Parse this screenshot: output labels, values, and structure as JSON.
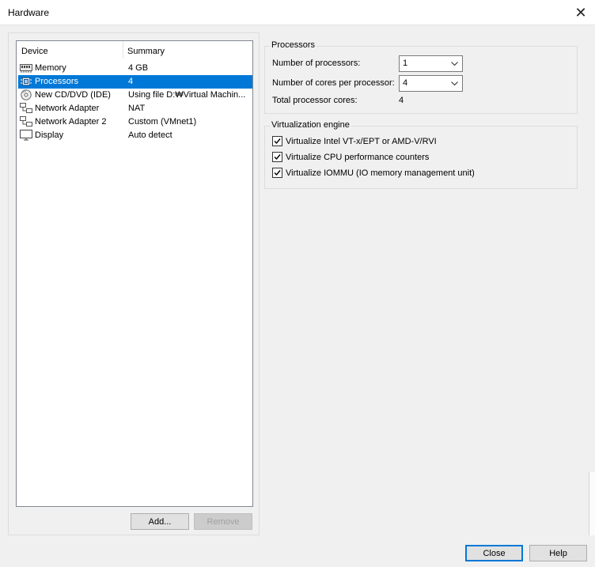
{
  "window": {
    "title": "Hardware"
  },
  "device_list": {
    "columns": {
      "device": "Device",
      "summary": "Summary"
    },
    "items": [
      {
        "name": "Memory",
        "summary": "4 GB",
        "icon": "memory-icon"
      },
      {
        "name": "Processors",
        "summary": "4",
        "icon": "processor-icon",
        "selected": true
      },
      {
        "name": "New CD/DVD (IDE)",
        "summary": "Using file D:₩Virtual Machin...",
        "icon": "cd-dvd-icon"
      },
      {
        "name": "Network Adapter",
        "summary": "NAT",
        "icon": "network-adapter-icon"
      },
      {
        "name": "Network Adapter 2",
        "summary": "Custom (VMnet1)",
        "icon": "network-adapter-icon"
      },
      {
        "name": "Display",
        "summary": "Auto detect",
        "icon": "display-icon"
      }
    ]
  },
  "buttons": {
    "add": "Add...",
    "remove": "Remove",
    "close": "Close",
    "help": "Help"
  },
  "processors": {
    "legend": "Processors",
    "num_processors_label": "Number of processors:",
    "num_processors_value": "1",
    "cores_label": "Number of cores per processor:",
    "cores_value": "4",
    "total_label": "Total processor cores:",
    "total_value": "4"
  },
  "virtualization": {
    "legend": "Virtualization engine",
    "options": [
      {
        "label": "Virtualize Intel VT-x/EPT or AMD-V/RVI",
        "checked": true
      },
      {
        "label": "Virtualize CPU performance counters",
        "checked": true
      },
      {
        "label": "Virtualize IOMMU (IO memory management unit)",
        "checked": true
      }
    ]
  },
  "colors": {
    "selection": "#0078d7",
    "default_button_border": "#0078d7"
  }
}
